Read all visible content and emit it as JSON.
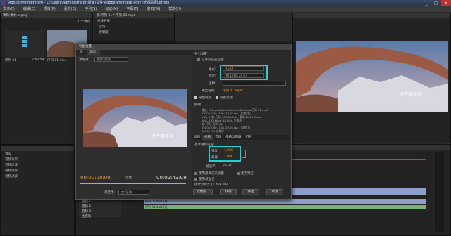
{
  "app": {
    "title": "Adobe Premiere Pro - C:\\Users\\Administrator\\桌面\\文件\\Adobe\\Premiere Pro\\小光探影图.prproj"
  },
  "window_buttons": {
    "min": "_",
    "max": "□",
    "close": "✕"
  },
  "menu": [
    "文件(F)",
    "编辑(E)",
    "项目(P)",
    "素材(C)",
    "序列(S)",
    "标记(M)",
    "字幕(T)",
    "窗口(W)",
    "帮助(H)"
  ],
  "project": {
    "tab": "项目:素材.prproj",
    "count": "1 个项目",
    "item_name": "序列 01",
    "item_time": "2:43:09",
    "clip_name": "序列 01.mp4",
    "clip_time": "2:43:09"
  },
  "effects": {
    "items": [
      "预设",
      "音频效果",
      "音频过渡",
      "视频效果",
      "视频过渡"
    ]
  },
  "source_panel": {
    "tab": "源:序列 01 * 序列 01.mp4",
    "rows": [
      "视频效果",
      "运动",
      "透明度",
      "时间重映射"
    ]
  },
  "dialog": {
    "title": "导出设置",
    "tabs": [
      "源",
      "输出"
    ],
    "source_label": "源缩放:",
    "source_value": "缩放以适合",
    "section_export": "导出设置",
    "match_sequence": "与序列设置匹配",
    "format_label": "格式:",
    "format_value": "H.264",
    "preset_label": "预设:",
    "preset_value": "HD 1080i 29.97",
    "comment_label": "注释:",
    "output_label": "输出名称:",
    "output_value": "序列 01.mp4",
    "export_video": "导出视频",
    "export_audio": "导出音频",
    "summary_title": "摘要",
    "summary_output": "输出: C:\\Users\\Administrator\\Desktop\\序列 01.mp4",
    "summary_lines": [
      "1920x1080 (1.0), 29.97 fps, 上场优先",
      "VBR, 1 次, 目标 10.00 Mbps, 最高 40.00 Mbps",
      "AAC, 192 kbps, 48 kHz, 立体声"
    ],
    "summary_source": "源: 序列, 序列 01",
    "summary_source_lines": [
      "1920x1080 (1.0), 29.97 fps, 上场优先",
      "48000 Hz, 立体声"
    ],
    "lower_tabs": [
      "滤镜",
      "视频",
      "音频",
      "多路复用器",
      "FTP"
    ],
    "basic_video": "基本视频设置",
    "width_label": "宽度:",
    "width_value": "1,920",
    "height_label": "高度:",
    "height_value": "1,080",
    "framerate_label": "帧速率:",
    "framerate_value": "29.97",
    "use_max_render": "使用最高渲染质量",
    "use_preview": "使用预览",
    "use_frame_blend": "使用帧混合",
    "file_size": "估计文件大小: 426 MB",
    "btn_metadata": "元数据...",
    "btn_queue": "队列",
    "btn_export": "导出",
    "btn_cancel": "取消",
    "timecode_in": "00:00:00:00",
    "timecode_out": "00:02:43:09",
    "fit_label": "适合",
    "source_range_label": "源范围:",
    "source_range_value": "工作区域",
    "watermark": "乔生聊百态"
  },
  "program": {
    "watermark": "乔生聊百态"
  },
  "timeline": {
    "tracks": [
      "视频 3",
      "视频 2",
      "视频 1",
      "音频 1",
      "音频 2",
      "主音轨"
    ],
    "clip_label": "序列 01.mp4 [视]",
    "audio_clip_label": "序列 01.mp4 [音]"
  }
}
